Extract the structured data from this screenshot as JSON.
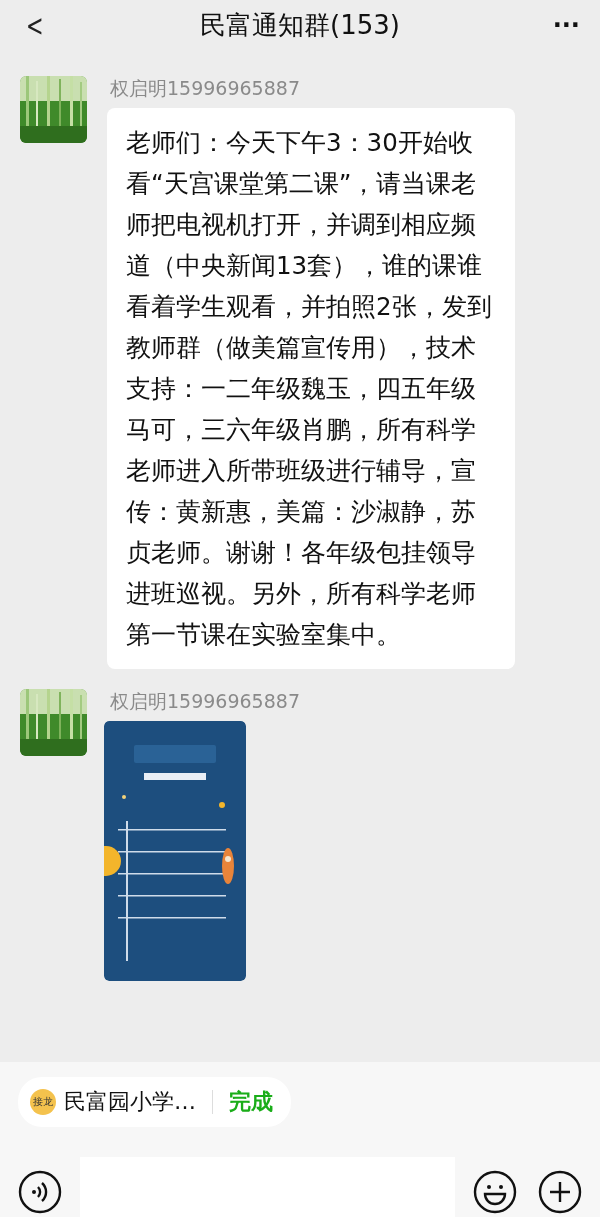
{
  "header": {
    "back": "<",
    "title": "民富通知群(153)",
    "more": "···"
  },
  "messages": [
    {
      "kind": "text",
      "sender": "权启明15996965887",
      "text": "老师们：今天下午3：30开始收看“天宫课堂第二课”，请当课老师把电视机打开，并调到相应频道（中央新闻13套），谁的课谁看着学生观看，并拍照2张，发到教师群（做美篇宣传用），技术支持：一二年级魏玉，四五年级马可，三六年级肖鹏，所有科学老师进入所带班级进行辅导，宣传：黄新惠，美篇：沙淑静，苏贞老师。谢谢！各年级包挂领导进班巡视。另外，所有科学老师第一节课在实验室集中。"
    },
    {
      "sender": "权启明15996965887"
    }
  ],
  "chip": {
    "badge": "接龙",
    "label": "民富园小学…",
    "action": "完成"
  }
}
